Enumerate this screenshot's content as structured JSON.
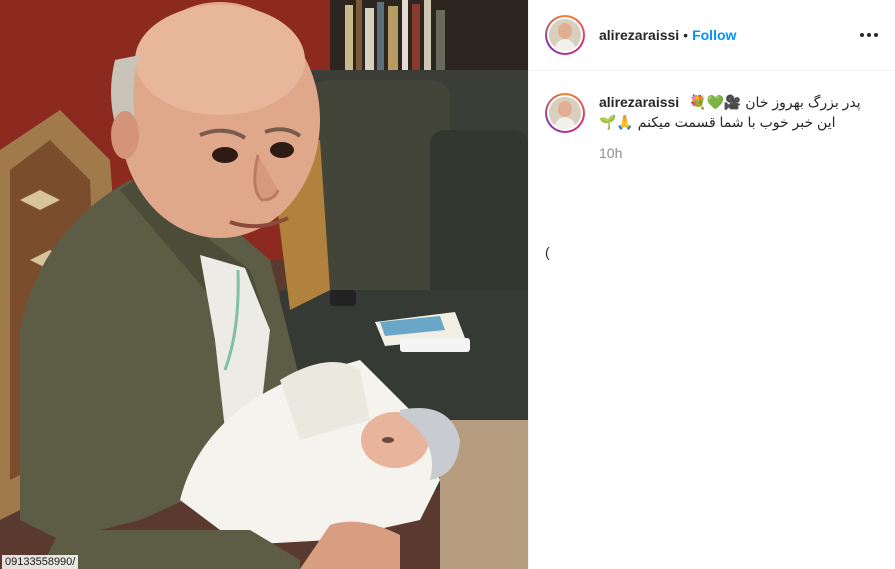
{
  "post": {
    "username": "alirezaraissi",
    "follow_label": "Follow",
    "separator": "•",
    "caption_line1": "پدر بزرگ بهروز خان 🎥💚💐",
    "caption_line2": "این خبر خوب با شما قسمت میکنم 🙏🌱",
    "time_ago": "10h",
    "stray_mark": "(",
    "watermark": "09133558990/"
  },
  "icons": {
    "more": "more-options-icon"
  },
  "colors": {
    "follow": "#0095f6",
    "text": "#262626",
    "muted": "#8e8e8e"
  }
}
